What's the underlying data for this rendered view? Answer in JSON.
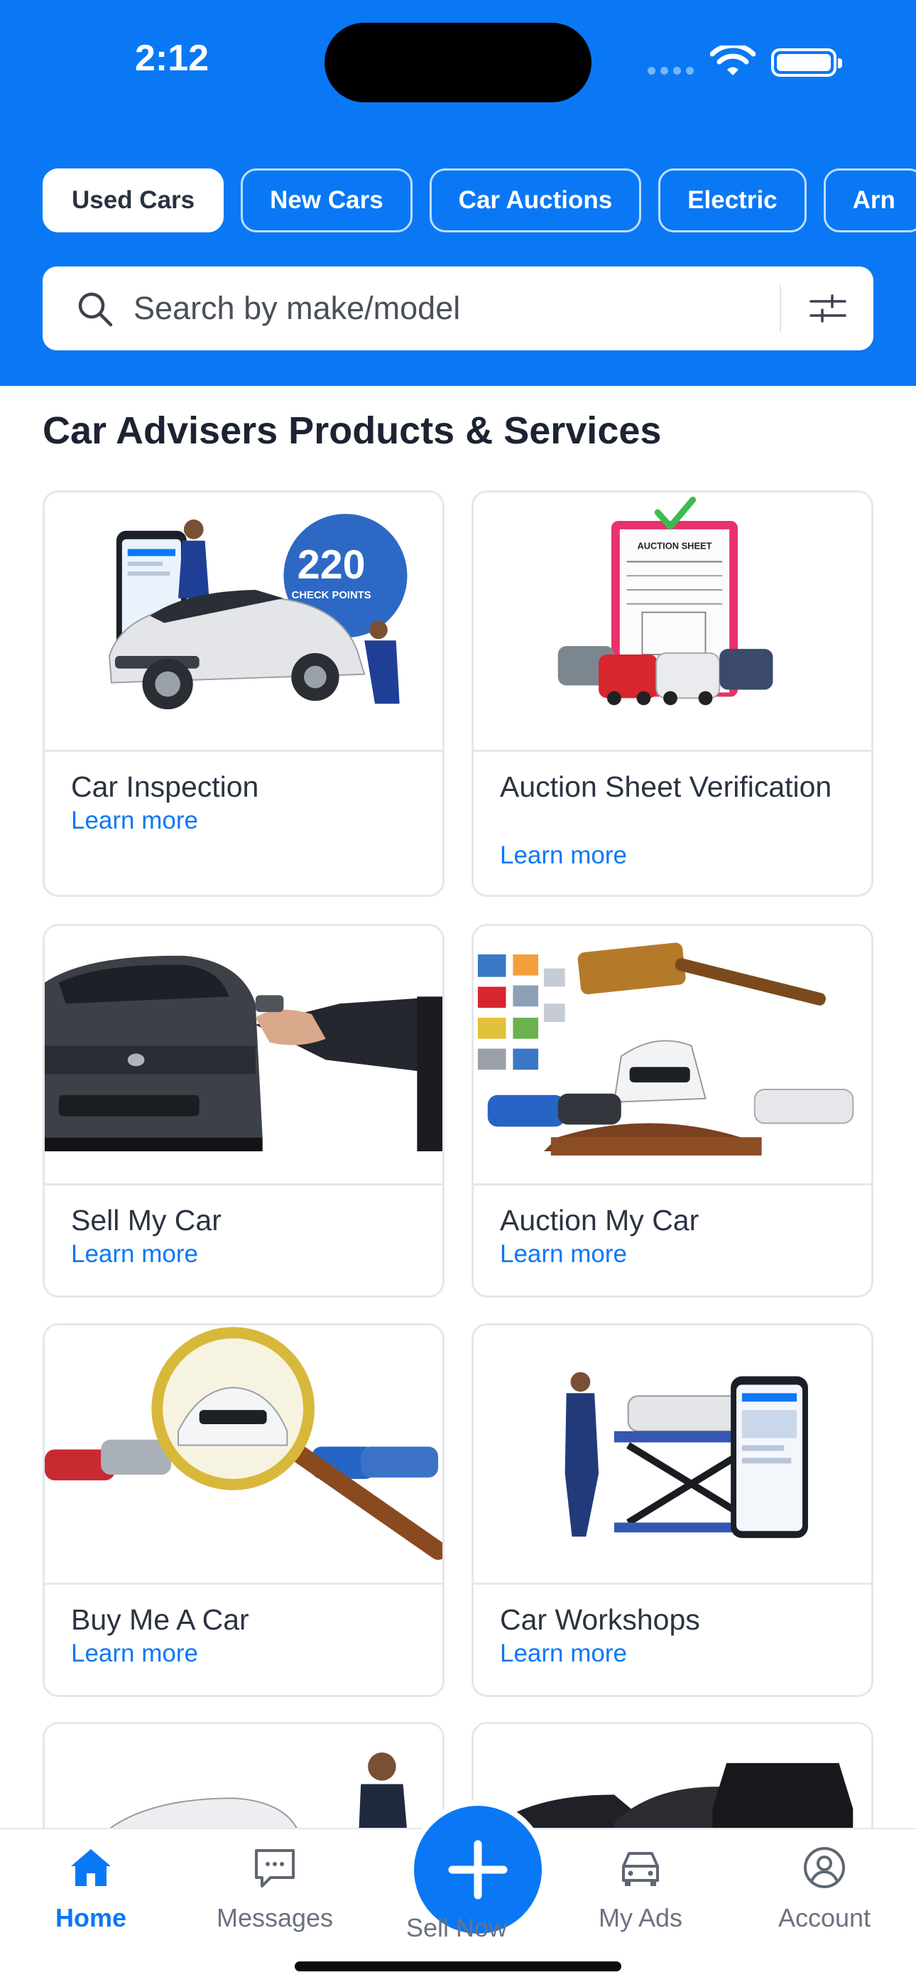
{
  "status_bar": {
    "time": "2:12"
  },
  "category_chips": [
    {
      "label": "Used Cars",
      "active": true
    },
    {
      "label": "New Cars",
      "active": false
    },
    {
      "label": "Car Auctions",
      "active": false
    },
    {
      "label": "Electric",
      "active": false
    },
    {
      "label": "Arn",
      "active": false
    }
  ],
  "search": {
    "placeholder": "Search by make/model"
  },
  "section": {
    "title": "Car Advisers Products & Services"
  },
  "cards": [
    {
      "title": "Car Inspection",
      "link": "Learn more",
      "badge_number": "220",
      "badge_text": "CHECK POINTS"
    },
    {
      "title": "Auction Sheet Verification",
      "link": "Learn more",
      "sheet_text": "AUCTION SHEET"
    },
    {
      "title": "Sell My Car",
      "link": "Learn more"
    },
    {
      "title": "Auction My Car",
      "link": "Learn more"
    },
    {
      "title": "Buy Me A Car",
      "link": "Learn more"
    },
    {
      "title": "Car Workshops",
      "link": "Learn more"
    }
  ],
  "tabbar": {
    "home": "Home",
    "messages": "Messages",
    "sell_now": "Sell Now",
    "my_ads": "My Ads",
    "account": "Account"
  },
  "colors": {
    "brand_blue": "#0a78f5",
    "text_dark": "#1c2333",
    "border": "#e4e7ec"
  }
}
